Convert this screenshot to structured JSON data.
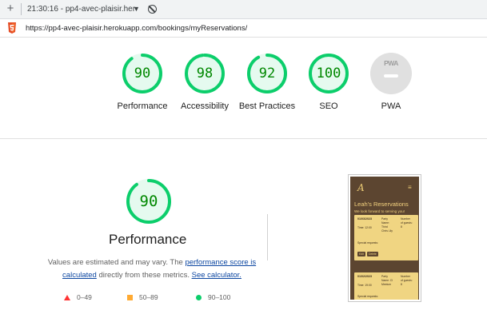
{
  "toolbar": {
    "new_tab_symbol": "+",
    "title": "21:30:16 - pp4-avec-plaisir.her",
    "caret": "▼",
    "plus_icon": "plus-icon",
    "block_icon": "block-icon"
  },
  "address_bar": {
    "url": "https://pp4-avec-plaisir.herokuapp.com/bookings/myReservations/",
    "icon": "html5-shield-icon"
  },
  "colors": {
    "pass": "#0cce6b",
    "pass_text": "#008800",
    "pass_fill": "#e5faef",
    "average": "#ffaa33",
    "fail": "#ff3333",
    "link": "#0d47a1"
  },
  "scores": [
    {
      "label": "Performance",
      "value": "90",
      "fraction": 0.9
    },
    {
      "label": "Accessibility",
      "value": "98",
      "fraction": 0.98
    },
    {
      "label": "Best Practices",
      "value": "92",
      "fraction": 0.92
    },
    {
      "label": "SEO",
      "value": "100",
      "fraction": 1.0
    }
  ],
  "pwa": {
    "label": "PWA",
    "badge_text": "PWA"
  },
  "performance": {
    "title": "Performance",
    "score": "90",
    "fraction": 0.9,
    "description_prefix": "Values are estimated and may vary. The ",
    "link_calc": "performance score is calculated",
    "description_middle": " directly from these metrics. ",
    "link_calculator": "See calculator."
  },
  "legend": [
    {
      "range": "0–49",
      "icon": "red-triangle-icon"
    },
    {
      "range": "50–89",
      "icon": "orange-square-icon"
    },
    {
      "range": "90–100",
      "icon": "green-circle-icon"
    }
  ],
  "screenshot": {
    "logo": "A",
    "menu_icon": "≡",
    "title": "Leah's Reservations",
    "subtitle": "We look forward to serving you!",
    "bookings": [
      {
        "date": "01/03/2023",
        "time": "Time: 12:00",
        "col2": [
          "Party",
          "Name:",
          "Third",
          "Chris Lily"
        ],
        "col3": [
          "Number",
          "of guests:",
          "8"
        ],
        "special": "Special requests:",
        "buttons": [
          "Edit",
          "Delete"
        ]
      },
      {
        "date": "01/02/2023",
        "time": "Time: 19:00",
        "col2": [
          "Party",
          "Name: Cl",
          "Meeium"
        ],
        "col3": [
          "Number",
          "of guests:",
          "8"
        ],
        "special": "Special requests:"
      }
    ]
  }
}
